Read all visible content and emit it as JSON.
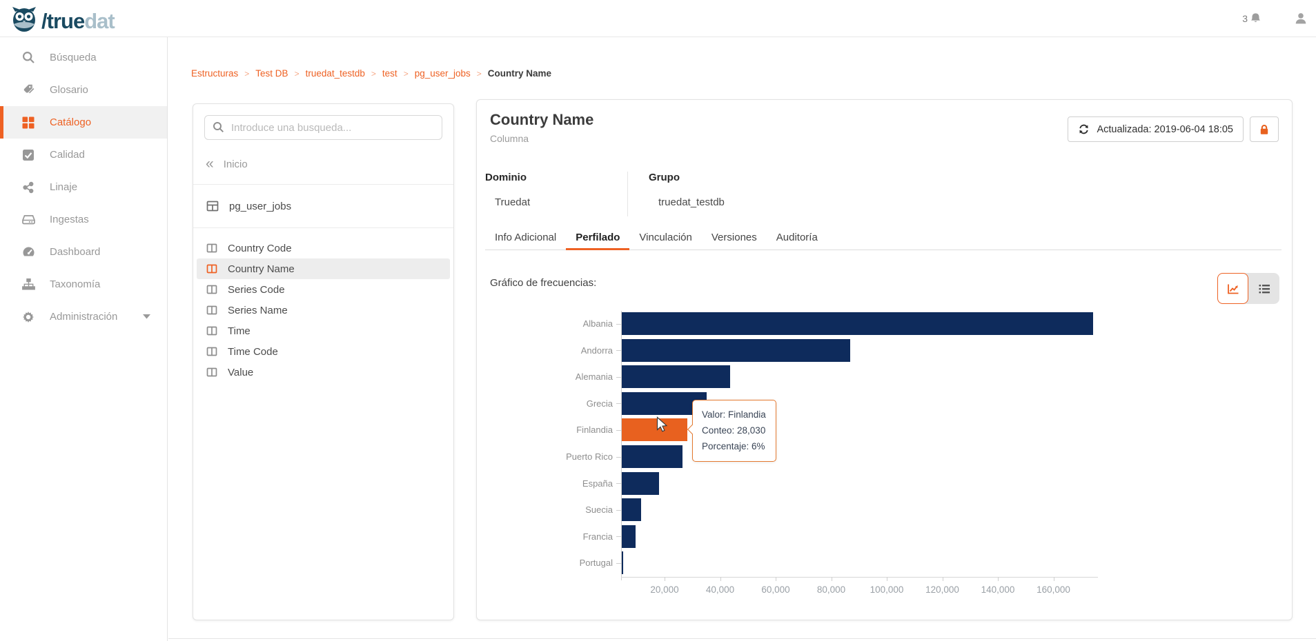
{
  "header": {
    "brand_slash": "/",
    "brand_dark": "true",
    "brand_light": "dat",
    "notification_count": "3"
  },
  "sidebar": {
    "items": [
      {
        "label": "Búsqueda",
        "icon": "search-icon"
      },
      {
        "label": "Glosario",
        "icon": "tags-icon"
      },
      {
        "label": "Catálogo",
        "icon": "grid-icon",
        "active": true
      },
      {
        "label": "Calidad",
        "icon": "check-square-icon"
      },
      {
        "label": "Linaje",
        "icon": "share-icon"
      },
      {
        "label": "Ingestas",
        "icon": "drive-icon"
      },
      {
        "label": "Dashboard",
        "icon": "gauge-icon"
      },
      {
        "label": "Taxonomía",
        "icon": "sitemap-icon"
      },
      {
        "label": "Administración",
        "icon": "gear-icon",
        "caret": true
      }
    ]
  },
  "breadcrumb": {
    "links": [
      "Estructuras",
      "Test DB",
      "truedat_testdb",
      "test",
      "pg_user_jobs"
    ],
    "current": "Country Name",
    "separator": ">"
  },
  "browser_panel": {
    "search_placeholder": "Introduce una busqueda...",
    "back_label": "Inicio",
    "table_name": "pg_user_jobs",
    "columns": [
      "Country Code",
      "Country Name",
      "Series Code",
      "Series Name",
      "Time",
      "Time Code",
      "Value"
    ],
    "selected_column": "Country Name"
  },
  "main": {
    "title": "Country Name",
    "subtitle": "Columna",
    "updated_label": "Actualizada: 2019-06-04 18:05",
    "domain_label": "Dominio",
    "domain_value": "Truedat",
    "group_label": "Grupo",
    "group_value": "truedat_testdb",
    "tabs": [
      "Info Adicional",
      "Perfilado",
      "Vinculación",
      "Versiones",
      "Auditoría"
    ],
    "active_tab": "Perfilado",
    "chart_section_label": "Gráfico de frecuencias:"
  },
  "chart_data": {
    "type": "bar",
    "orientation": "horizontal",
    "title": "Gráfico de frecuencias",
    "categories": [
      "Albania",
      "Andorra",
      "Alemania",
      "Grecia",
      "Finlandia",
      "Puerto Rico",
      "España",
      "Suecia",
      "Francia",
      "Portugal"
    ],
    "values": [
      174000,
      86500,
      43400,
      34900,
      28030,
      26200,
      17800,
      11300,
      9300,
      4800
    ],
    "highlight": {
      "index": 4,
      "category": "Finlandia",
      "count": "28,030",
      "percentage": "6%"
    },
    "x_ticks": [
      20000,
      40000,
      60000,
      80000,
      100000,
      120000,
      140000,
      160000
    ],
    "x_tick_labels": [
      "20,000",
      "40,000",
      "60,000",
      "80,000",
      "100,000",
      "120,000",
      "140,000",
      "160,000"
    ],
    "xlim": [
      0,
      174000
    ],
    "grid": false,
    "bar_color": "#0e2b5c",
    "highlight_color": "#e8611f",
    "tooltip_lines": [
      "Valor: Finlandia",
      "Conteo: 28,030",
      "Porcentaje: 6%"
    ]
  },
  "colors": {
    "accent": "#ee6123",
    "navy": "#0e2b5c"
  }
}
